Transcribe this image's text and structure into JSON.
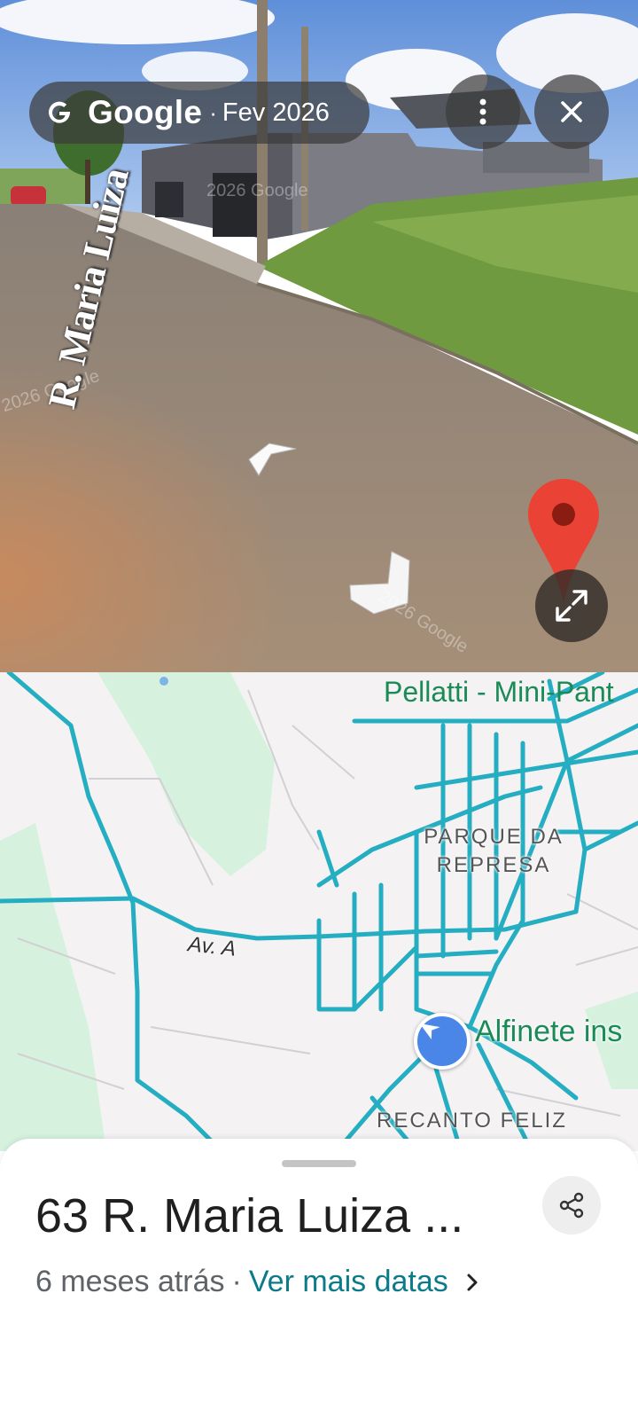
{
  "streetview": {
    "brand": "Google",
    "separator": "·",
    "date": "Fev 2026",
    "street_name": "R. Maria Luiza",
    "watermark": "2026 Google",
    "icons": {
      "logo": "google-g-icon",
      "more": "more-vert-icon",
      "close": "close-icon",
      "expand": "expand-icon",
      "pin": "red-map-pin-icon"
    }
  },
  "map": {
    "poi_label": "Pellatti - Mini-Pant",
    "area_1_line_1": "PARQUE DA",
    "area_1_line_2": "REPRESA",
    "road_label": "Av. A",
    "pin_label": "Alfinete ins",
    "area_2": "RECANTO FELIZ",
    "colors": {
      "background": "#f4f2f3",
      "green_area": "#d6f2df",
      "road_highlight": "#25aec1",
      "label_green": "#1a8a57"
    }
  },
  "sheet": {
    "title": "63 R. Maria Luiza ...",
    "age": "6 meses atrás",
    "separator": "·",
    "more_dates": "Ver mais datas",
    "colors": {
      "link": "#0b7b8a"
    }
  }
}
